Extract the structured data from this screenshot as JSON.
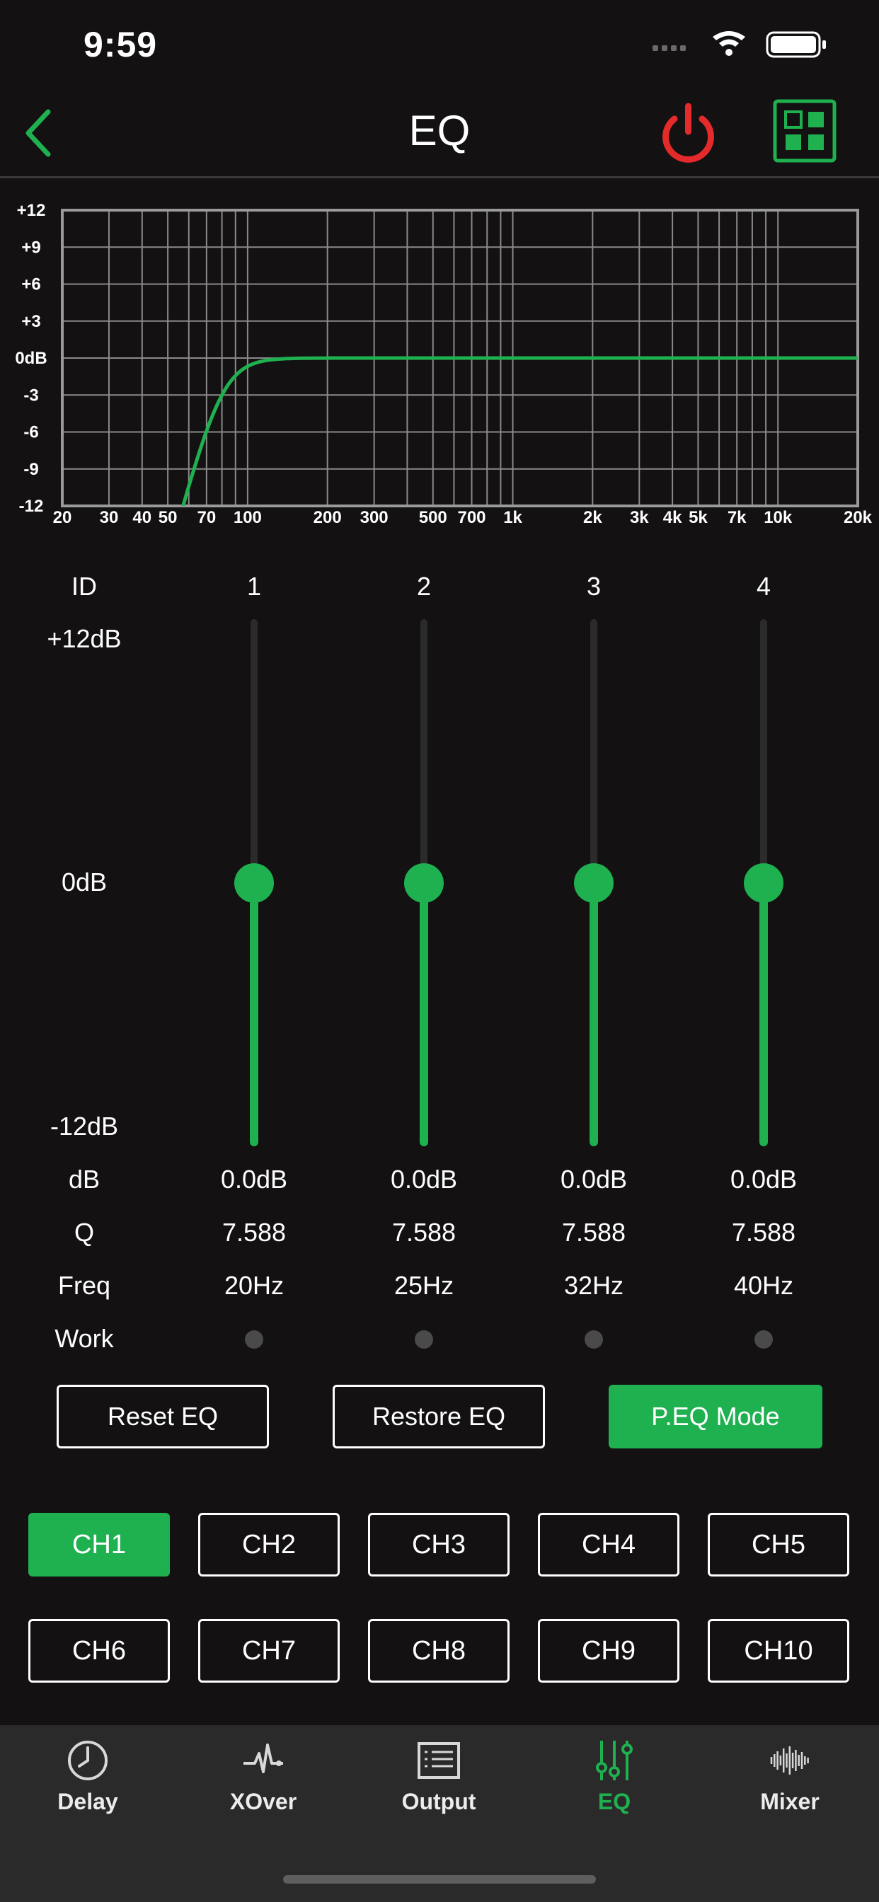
{
  "status": {
    "time": "9:59"
  },
  "nav": {
    "title": "EQ"
  },
  "colors": {
    "accent": "#1fb050",
    "power": "#e42a2a",
    "background": "#131111",
    "grid": "#8a8a8a"
  },
  "graph": {
    "y_labels": [
      "+12",
      "+9",
      "+6",
      "+3",
      "0dB",
      "-3",
      "-6",
      "-9",
      "-12"
    ],
    "x_labels": [
      "20",
      "30",
      "40",
      "50",
      "70",
      "100",
      "200",
      "300",
      "500",
      "700",
      "1k",
      "2k",
      "3k",
      "4k",
      "5k",
      "7k",
      "10k",
      "20k"
    ],
    "x_range_hz": [
      20,
      20000
    ],
    "y_range_db": [
      -12,
      12
    ],
    "curve": "high-pass ~80Hz, flat 0dB above"
  },
  "table": {
    "id_label": "ID",
    "top_label": "+12dB",
    "mid_label": "0dB",
    "bottom_label": "-12dB",
    "db_label": "dB",
    "q_label": "Q",
    "freq_label": "Freq",
    "work_label": "Work",
    "bands": [
      {
        "id": "1",
        "db": "0.0dB",
        "q": "7.588",
        "freq": "20Hz",
        "gain": 0
      },
      {
        "id": "2",
        "db": "0.0dB",
        "q": "7.588",
        "freq": "25Hz",
        "gain": 0
      },
      {
        "id": "3",
        "db": "0.0dB",
        "q": "7.588",
        "freq": "32Hz",
        "gain": 0
      },
      {
        "id": "4",
        "db": "0.0dB",
        "q": "7.588",
        "freq": "40Hz",
        "gain": 0
      }
    ]
  },
  "actions": {
    "reset": "Reset EQ",
    "restore": "Restore EQ",
    "mode": "P.EQ Mode"
  },
  "channels": [
    "CH1",
    "CH2",
    "CH3",
    "CH4",
    "CH5",
    "CH6",
    "CH7",
    "CH8",
    "CH9",
    "CH10"
  ],
  "selected_channel": "CH1",
  "tabs": [
    {
      "label": "Delay",
      "icon": "clock-icon"
    },
    {
      "label": "XOver",
      "icon": "waveform-icon"
    },
    {
      "label": "Output",
      "icon": "list-icon"
    },
    {
      "label": "EQ",
      "icon": "sliders-icon"
    },
    {
      "label": "Mixer",
      "icon": "bars-icon"
    }
  ],
  "active_tab": "EQ"
}
